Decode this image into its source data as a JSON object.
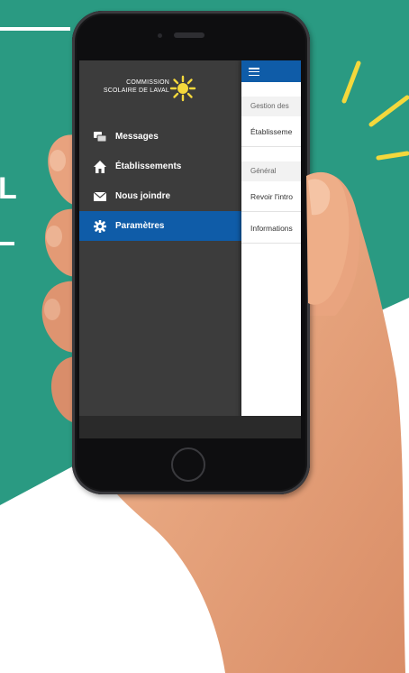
{
  "colors": {
    "background_green": "#2a9a82",
    "background_white": "#ffffff",
    "accent_yellow": "#f4d83c",
    "drawer_bg": "#3c3c3c",
    "active_blue": "#0f5ca8",
    "skin": "#e8a27e"
  },
  "background": {
    "letter": "L"
  },
  "app": {
    "logo": {
      "line1": "COMMISSION",
      "line2": "SCOLAIRE DE LAVAL",
      "icon": "sun-logo-icon"
    },
    "menu": [
      {
        "label": "Messages",
        "icon": "messages-icon",
        "active": false
      },
      {
        "label": "Établissements",
        "icon": "home-icon",
        "active": false
      },
      {
        "label": "Nous joindre",
        "icon": "envelope-icon",
        "active": false
      },
      {
        "label": "Paramètres",
        "icon": "gear-icon",
        "active": true
      }
    ],
    "content": {
      "menu_icon": "hamburger-icon",
      "sections": [
        {
          "header": "Gestion des",
          "rows": [
            "Établisseme"
          ]
        },
        {
          "header": "Général",
          "rows": [
            "Revoir l'intro",
            "Informations"
          ]
        }
      ]
    }
  }
}
